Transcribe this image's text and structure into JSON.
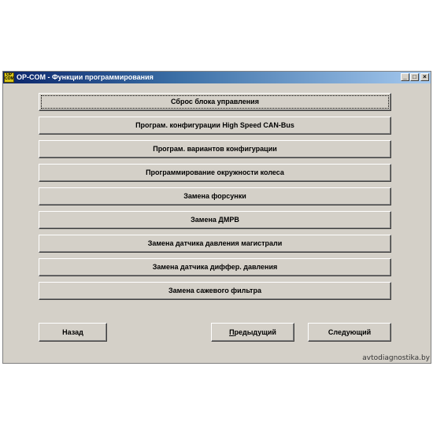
{
  "window": {
    "title": "OP-COM - Функции программирования",
    "icon_text": [
      "OP",
      "COM"
    ],
    "controls": {
      "minimize": "_",
      "maximize": "□",
      "close": "×"
    }
  },
  "functions": [
    "Сброс блока управления",
    "Програм. конфигурации High Speed CAN-Bus",
    "Програм. вариантов конфигурации",
    "Программирование окружности колеса",
    "Замена форсунки",
    "Замена ДМРВ",
    "Замена датчика давления магистрали",
    "Замена датчика диффер. давления",
    "Замена сажевого фильтра"
  ],
  "nav": {
    "back": "Назад",
    "previous_underlined": "П",
    "previous_rest": "редыдущий",
    "next": "Следующий"
  },
  "watermark": "avtodiagnostika.by"
}
